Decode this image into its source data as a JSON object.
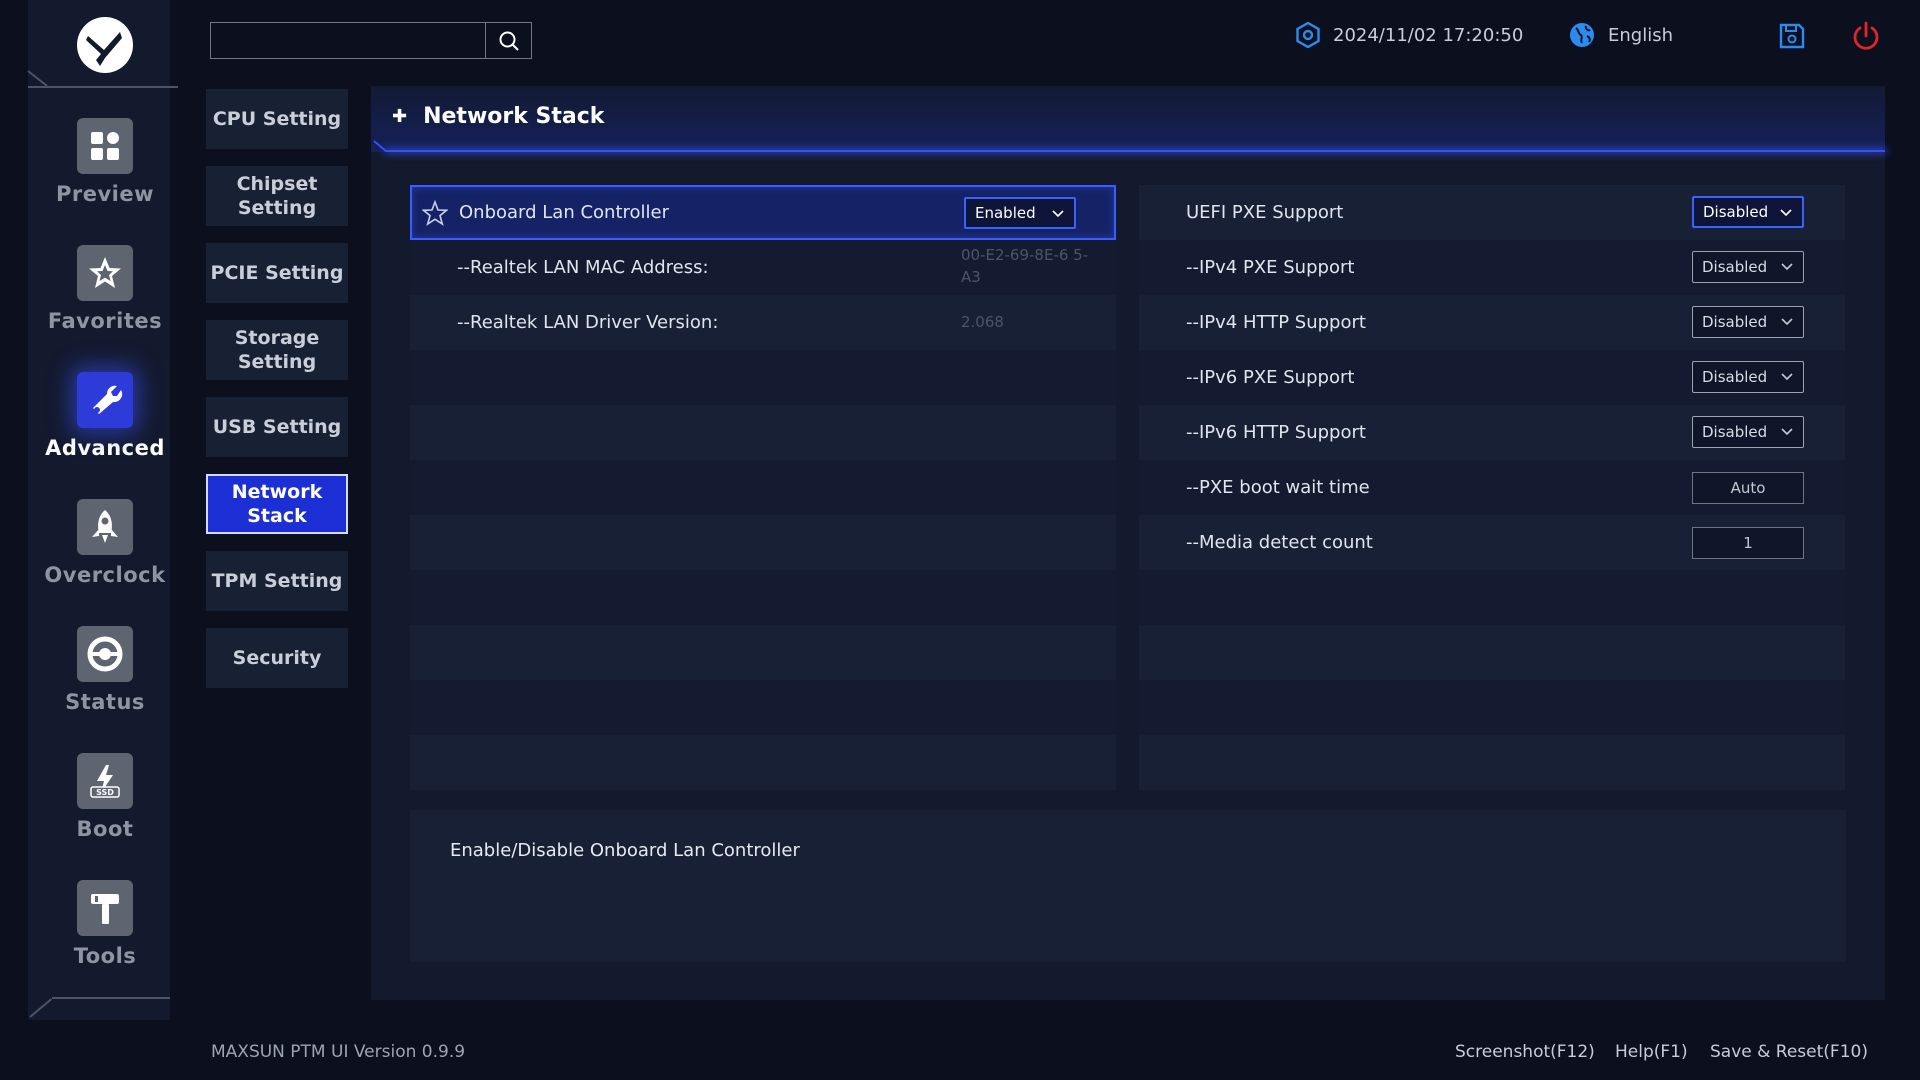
{
  "app": {
    "version_text": "MAXSUN PTM UI Version 0.9.9"
  },
  "top": {
    "search_placeholder": "",
    "datetime": "2024/11/02 17:20:50",
    "language": "English"
  },
  "rail": {
    "items": [
      {
        "label": "Preview",
        "icon": "grid-icon"
      },
      {
        "label": "Favorites",
        "icon": "star-icon"
      },
      {
        "label": "Advanced",
        "icon": "wrench-icon",
        "active": true
      },
      {
        "label": "Overclock",
        "icon": "rocket-icon"
      },
      {
        "label": "Status",
        "icon": "gauge-icon"
      },
      {
        "label": "Boot",
        "icon": "ssd-icon"
      },
      {
        "label": "Tools",
        "icon": "hammer-icon"
      }
    ]
  },
  "submenu": {
    "items": [
      {
        "label": "CPU Setting"
      },
      {
        "label": "Chipset Setting"
      },
      {
        "label": "PCIE Setting"
      },
      {
        "label": "Storage Setting"
      },
      {
        "label": "USB Setting"
      },
      {
        "label": "Network Stack",
        "active": true
      },
      {
        "label": "TPM Setting"
      },
      {
        "label": "Security"
      }
    ]
  },
  "panel": {
    "title": "Network Stack",
    "left_rows": [
      {
        "label": "Onboard Lan Controller",
        "control": "dropdown",
        "value": "Enabled",
        "selected": true
      },
      {
        "label": "--Realtek LAN MAC Address:",
        "value": "00-E2-69-8E-6 5-A3"
      },
      {
        "label": "--Realtek LAN Driver Version:",
        "value": "2.068"
      }
    ],
    "right_rows": [
      {
        "label": "UEFI PXE Support",
        "control": "dropdown",
        "value": "Disabled",
        "focused": true
      },
      {
        "label": "--IPv4 PXE Support",
        "control": "dropdown",
        "value": "Disabled"
      },
      {
        "label": "--IPv4 HTTP Support",
        "control": "dropdown",
        "value": "Disabled"
      },
      {
        "label": "--IPv6 PXE Support",
        "control": "dropdown",
        "value": "Disabled"
      },
      {
        "label": "--IPv6 HTTP Support",
        "control": "dropdown",
        "value": "Disabled"
      },
      {
        "label": "--PXE boot wait time",
        "control": "input",
        "value": "Auto"
      },
      {
        "label": "--Media detect count",
        "control": "input",
        "value": "1"
      }
    ],
    "help_text": "Enable/Disable Onboard Lan Controller"
  },
  "footer": {
    "screenshot": "Screenshot(F12)",
    "help": "Help(F1)",
    "save_reset": "Save & Reset(F10)"
  },
  "colors": {
    "accent": "#2e52ff",
    "active_bg": "#1c2fd4",
    "power": "#e0262b",
    "info_icon": "#2a8cf0"
  }
}
